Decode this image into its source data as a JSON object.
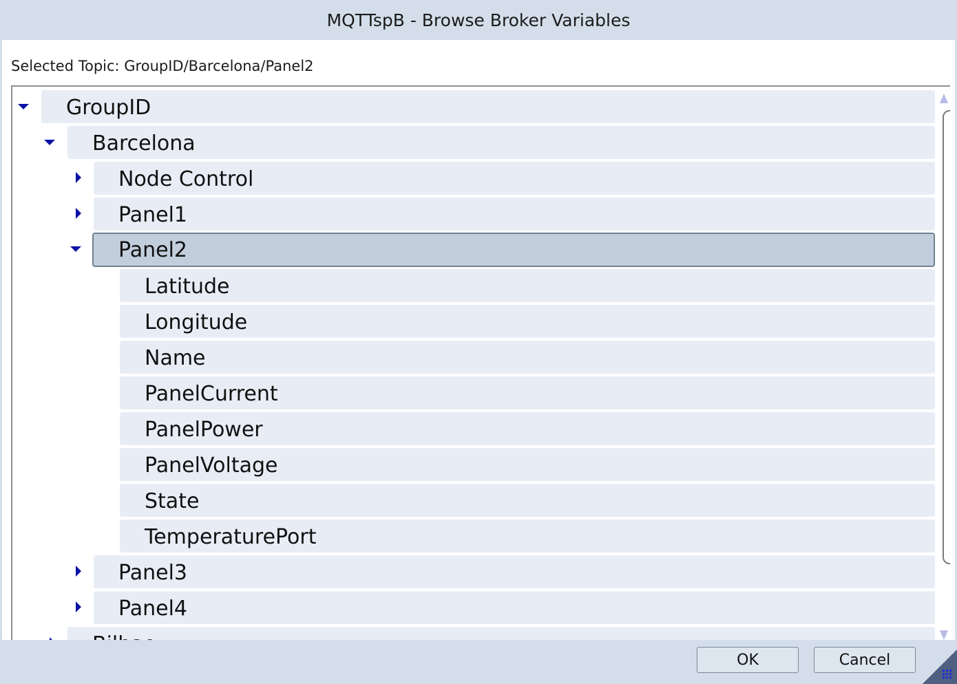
{
  "window": {
    "title": "MQTTspB - Browse Broker Variables"
  },
  "selected_topic": "Selected Topic: GroupID/Barcelona/Panel2",
  "tree": {
    "group": "GroupID",
    "site": "Barcelona",
    "node_control": "Node Control",
    "panel1": "Panel1",
    "panel2": "Panel2",
    "panel2_children": [
      "Latitude",
      "Longitude",
      "Name",
      "PanelCurrent",
      "PanelPower",
      "PanelVoltage",
      "State",
      "TemperaturePort"
    ],
    "panel3": "Panel3",
    "panel4": "Panel4",
    "partial_next": "Bilbao"
  },
  "buttons": {
    "ok": "OK",
    "cancel": "Cancel"
  },
  "colors": {
    "chrome": "#d3deea",
    "row_bg": "#e8edf5",
    "selected_row": "#c3cedc",
    "expander_arrow": "#0b12a6"
  }
}
